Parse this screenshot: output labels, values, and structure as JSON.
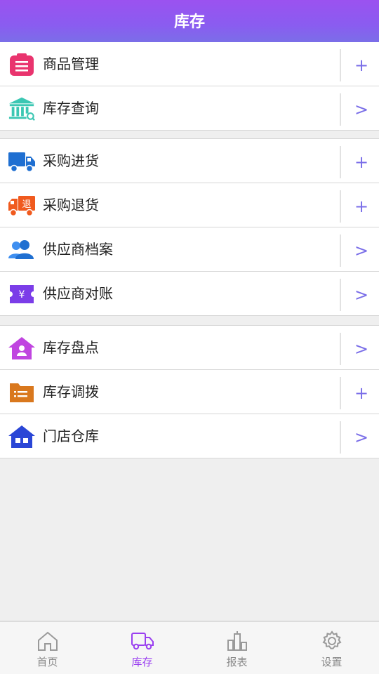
{
  "header": {
    "title": "库存"
  },
  "groups": [
    {
      "items": [
        {
          "label": "商品管理",
          "action": "+",
          "icon": "clipboard-icon"
        },
        {
          "label": "库存查询",
          "action": ">",
          "icon": "warehouse-search-icon"
        }
      ]
    },
    {
      "items": [
        {
          "label": "采购进货",
          "action": "+",
          "icon": "truck-icon"
        },
        {
          "label": "采购退货",
          "action": "+",
          "icon": "return-truck-icon"
        },
        {
          "label": "供应商档案",
          "action": ">",
          "icon": "users-icon"
        },
        {
          "label": "供应商对账",
          "action": ">",
          "icon": "yen-ticket-icon"
        }
      ]
    },
    {
      "items": [
        {
          "label": "库存盘点",
          "action": ">",
          "icon": "home-person-icon"
        },
        {
          "label": "库存调拨",
          "action": "+",
          "icon": "folder-icon"
        },
        {
          "label": "门店仓库",
          "action": ">",
          "icon": "store-house-icon"
        }
      ]
    }
  ],
  "return_badge": "退",
  "tabbar": {
    "tabs": [
      {
        "label": "首页",
        "icon": "home-icon",
        "active": false
      },
      {
        "label": "库存",
        "icon": "delivery-truck-icon",
        "active": true
      },
      {
        "label": "报表",
        "icon": "bar-chart-icon",
        "active": false
      },
      {
        "label": "设置",
        "icon": "gear-icon",
        "active": false
      }
    ]
  },
  "colors": {
    "header_start": "#9b52f0",
    "header_end": "#7b6ee8",
    "action": "#7a6ee8",
    "tab_active": "#9a3ff0",
    "tab_inactive": "#8a8a8a"
  }
}
